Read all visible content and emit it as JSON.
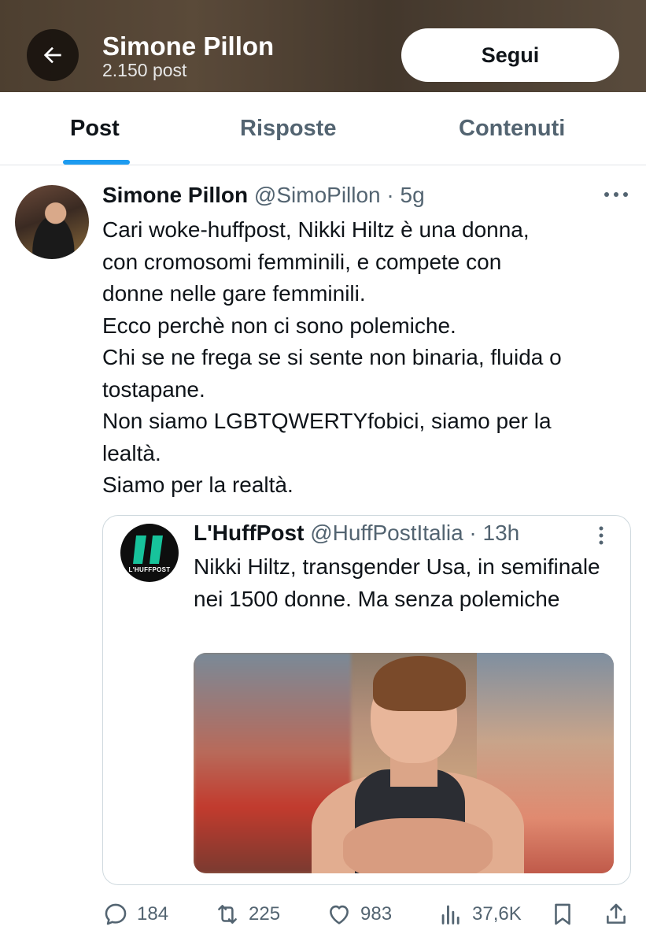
{
  "header": {
    "name": "Simone Pillon",
    "post_count": "2.150 post",
    "follow_label": "Segui"
  },
  "tabs": [
    {
      "label": "Post",
      "active": true
    },
    {
      "label": "Risposte",
      "active": false
    },
    {
      "label": "Contenuti",
      "active": false
    }
  ],
  "tweet": {
    "name": "Simone Pillon",
    "handle_time": "@SimoPillon · 5g",
    "text": "Cari woke-huffpost, Nikki Hiltz è una donna,\ncon cromosomi femminili, e compete con\ndonne nelle gare femminili.\nEcco perchè non ci sono polemiche.\nChi se ne frega se si sente non binaria, fluida o\ntostapane.\nNon siamo LGBTQWERTYfobici, siamo per la\nlealtà.\nSiamo per la realtà.",
    "quote": {
      "logo_text": "L'HUFFPOST",
      "name": "L'HuffPost",
      "handle_time": "@HuffPostItalia · 13h",
      "text": "Nikki Hiltz, transgender Usa, in semifinale nei 1500 donne. Ma senza polemiche"
    },
    "stats": {
      "replies": "184",
      "retweets": "225",
      "likes": "983",
      "views": "37,6K"
    }
  },
  "colors": {
    "accent": "#1d9bf0",
    "text": "#0f1419",
    "secondary": "#536471"
  }
}
